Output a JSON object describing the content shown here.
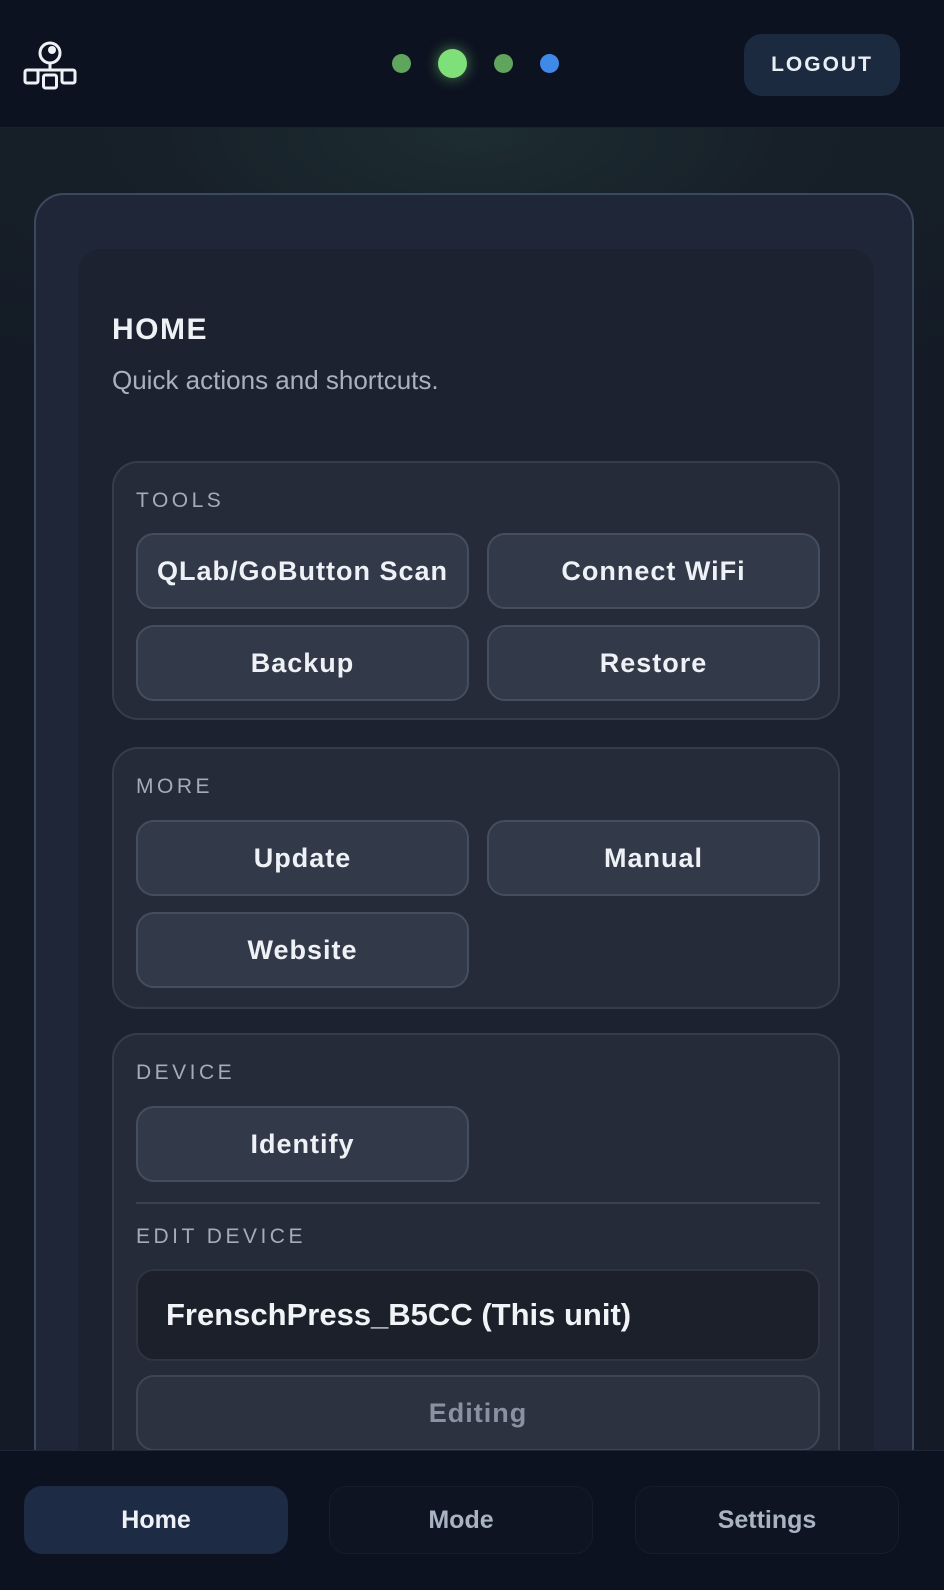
{
  "header": {
    "logo_icon": "network-nodes-icon",
    "status_dots": [
      {
        "name": "status-dot-1",
        "color": "#5fa65c"
      },
      {
        "name": "status-dot-2-active",
        "color": "#7fe07a"
      },
      {
        "name": "status-dot-3",
        "color": "#5fa65c"
      },
      {
        "name": "status-dot-4",
        "color": "#3f8ae8"
      }
    ],
    "logout_label": "LOGOUT"
  },
  "page": {
    "title": "HOME",
    "subtitle": "Quick actions and shortcuts."
  },
  "tools": {
    "label": "TOOLS",
    "buttons": [
      "QLab/GoButton Scan",
      "Connect WiFi",
      "Backup",
      "Restore"
    ]
  },
  "more": {
    "label": "MORE",
    "buttons": [
      "Update",
      "Manual",
      "Website"
    ]
  },
  "device": {
    "label": "DEVICE",
    "identify_label": "Identify",
    "edit_label": "EDIT DEVICE",
    "device_name": "FrenschPress_B5CC (This unit)",
    "editing_label": "Editing"
  },
  "nav": {
    "tabs": [
      {
        "label": "Home",
        "active": true
      },
      {
        "label": "Mode",
        "active": false
      },
      {
        "label": "Settings",
        "active": false
      }
    ]
  }
}
